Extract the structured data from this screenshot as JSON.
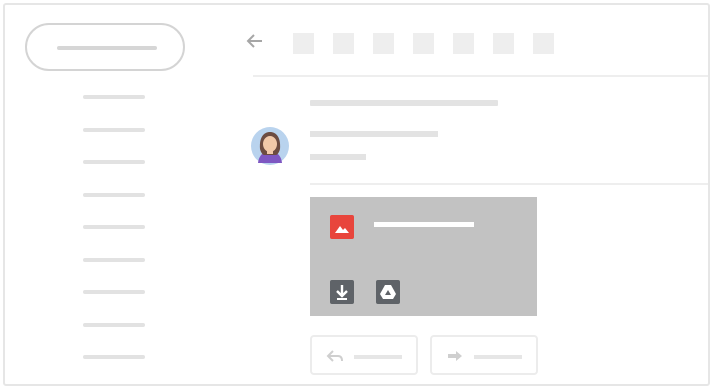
{
  "app": {
    "kind": "email-client-illustration"
  },
  "colors": {
    "frame_border": "#e6e6e6",
    "placeholder_bar": "#e3e3e3",
    "attachment_bg": "#c2c2c2",
    "image_icon_red": "#e8453c",
    "action_icon_dark": "#5f6368",
    "avatar_skin": "#f2c9a9",
    "avatar_hair": "#6d4c41",
    "avatar_bg": "#b9d3ee"
  },
  "sidebar": {
    "compose_icon": "compose-pill",
    "nav_item_count": 9
  },
  "toolbar": {
    "back_icon": "back-arrow-icon",
    "action_placeholder_count": 7
  },
  "message": {
    "avatar_icon": "person-avatar-icon"
  },
  "attachment": {
    "type_icon": "image-icon",
    "actions": [
      "download-icon",
      "google-drive-icon"
    ]
  },
  "actions": {
    "reply_icon": "reply-arrow-icon",
    "forward_icon": "forward-arrow-icon"
  }
}
